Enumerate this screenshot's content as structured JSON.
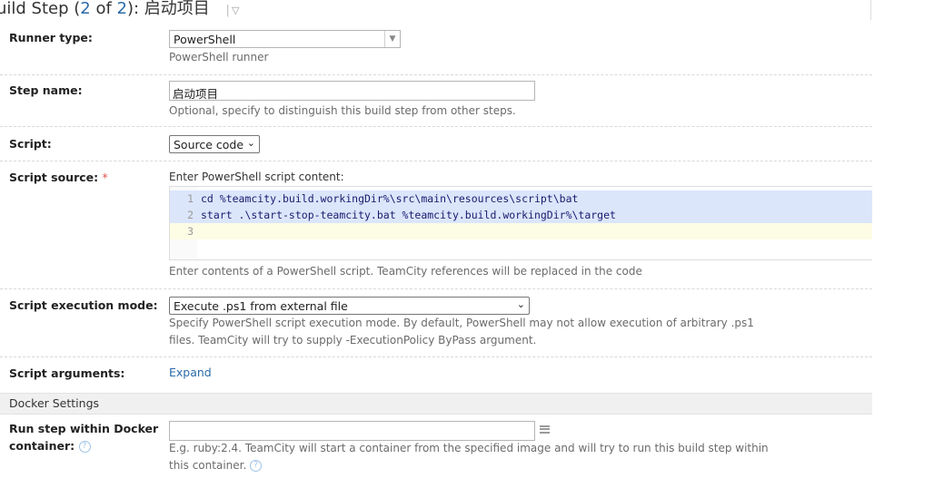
{
  "page": {
    "title_prefix": "uild Step (",
    "title_step": "2",
    "title_of": " of ",
    "title_total": "2",
    "title_suffix": "): 启动项目",
    "title_menu_arrow": "▽",
    "title_menu_separator": "|"
  },
  "runner_type": {
    "label": "Runner type:",
    "value": "PowerShell",
    "hint": "PowerShell runner"
  },
  "step_name": {
    "label": "Step name:",
    "value": "启动项目",
    "hint": "Optional, specify to distinguish this build step from other steps."
  },
  "script": {
    "label": "Script:",
    "value": "Source code"
  },
  "script_source": {
    "label": "Script source:",
    "required_mark": "*",
    "intro": "Enter PowerShell script content:",
    "lines": [
      {
        "n": "1",
        "text": "cd %teamcity.build.workingDir%\\src\\main\\resources\\script\\bat"
      },
      {
        "n": "2",
        "text": "start .\\start-stop-teamcity.bat %teamcity.build.workingDir%\\target"
      },
      {
        "n": "3",
        "text": ""
      }
    ],
    "hint": "Enter contents of a PowerShell script. TeamCity references will be replaced in the code"
  },
  "execution_mode": {
    "label": "Script execution mode:",
    "value": "Execute .ps1 from external file",
    "hint_line1": "Specify PowerShell script execution mode. By default, PowerShell may not allow execution of arbitrary .ps1",
    "hint_line2": "files. TeamCity will try to supply -ExecutionPolicy ByPass argument."
  },
  "script_arguments": {
    "label": "Script arguments:",
    "link": "Expand"
  },
  "docker": {
    "section_title": "Docker Settings",
    "label_line1": "Run step within Docker",
    "label_line2": "container:",
    "help_glyph": "?",
    "value": "",
    "hint_line1": "E.g. ruby:2.4. TeamCity will start a container from the specified image and will try to run this build step within",
    "hint_line2": "this container."
  },
  "colors": {
    "link": "#2b6aa8",
    "required": "#d9534f",
    "selection": "#dbe6fb",
    "current_line": "#fdfce5"
  }
}
